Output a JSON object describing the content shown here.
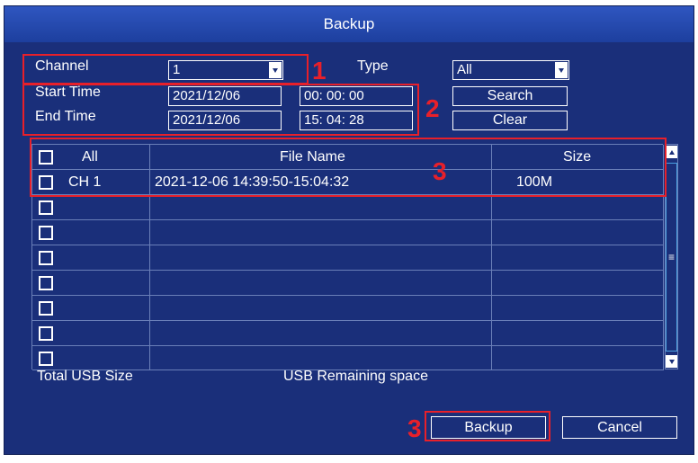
{
  "window": {
    "title": "Backup"
  },
  "form": {
    "channel_label": "Channel",
    "channel_value": "1",
    "type_label": "Type",
    "type_value": "All",
    "start_label": "Start Time",
    "start_date": "2021/12/06",
    "start_time": "00: 00: 00",
    "end_label": "End Time",
    "end_date": "2021/12/06",
    "end_time": "15: 04: 28",
    "search_label": "Search",
    "clear_label": "Clear"
  },
  "table": {
    "col_all": "All",
    "col_filename": "File Name",
    "col_size": "Size",
    "rows": [
      {
        "channel": "CH 1",
        "filename": "2021-12-06 14:39:50-15:04:32",
        "size": "100M"
      }
    ]
  },
  "scrollbar": {
    "thumb_glyph": "≡"
  },
  "footer": {
    "total_usb_label": "Total USB Size",
    "usb_remaining_label": "USB Remaining space",
    "backup_label": "Backup",
    "cancel_label": "Cancel"
  },
  "annotations": {
    "n1": "1",
    "n2": "2",
    "n3a": "3",
    "n3b": "3",
    "color": "#e8202a"
  }
}
